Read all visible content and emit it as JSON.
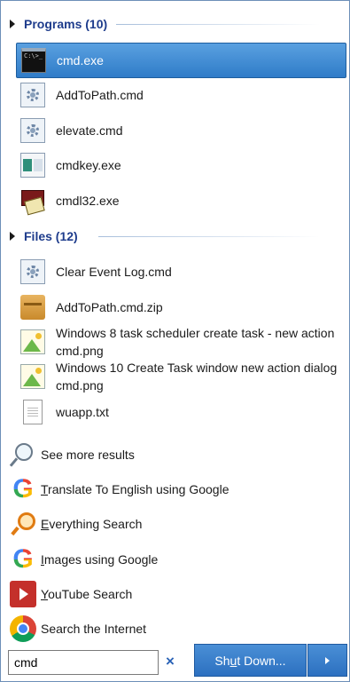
{
  "programs": {
    "header": "Programs (10)",
    "items": [
      {
        "label": "cmd.exe",
        "icon": "cmd-icon",
        "selected": true
      },
      {
        "label": "AddToPath.cmd",
        "icon": "gear-icon"
      },
      {
        "label": "elevate.cmd",
        "icon": "gear-icon"
      },
      {
        "label": "cmdkey.exe",
        "icon": "key-icon"
      },
      {
        "label": "cmdl32.exe",
        "icon": "dialer-icon"
      }
    ]
  },
  "files": {
    "header": "Files (12)",
    "items": [
      {
        "label": "Clear Event Log.cmd",
        "icon": "gear-icon"
      },
      {
        "label": "AddToPath.cmd.zip",
        "icon": "zip-icon"
      },
      {
        "label": "Windows 8 task scheduler create task - new action cmd.png",
        "icon": "image-icon"
      },
      {
        "label": "Windows 10 Create Task window new action dialog cmd.png",
        "icon": "image-icon"
      },
      {
        "label": "wuapp.txt",
        "icon": "text-file-icon"
      }
    ]
  },
  "actions": {
    "see_more": "See more results",
    "translate_u": "T",
    "translate_rest": "ranslate To English using Google",
    "everything_u": "E",
    "everything_rest": "verything Search",
    "images_u": "I",
    "images_rest": "mages using Google",
    "youtube_u": "Y",
    "youtube_rest": "ouTube Search",
    "internet": "Search the Internet"
  },
  "search": {
    "value": "cmd",
    "clear_symbol": "×"
  },
  "shutdown": {
    "label_pre": "Sh",
    "label_u": "u",
    "label_post": "t Down..."
  },
  "colors": {
    "accent": "#2f7cc8",
    "header": "#1e3c8c"
  }
}
